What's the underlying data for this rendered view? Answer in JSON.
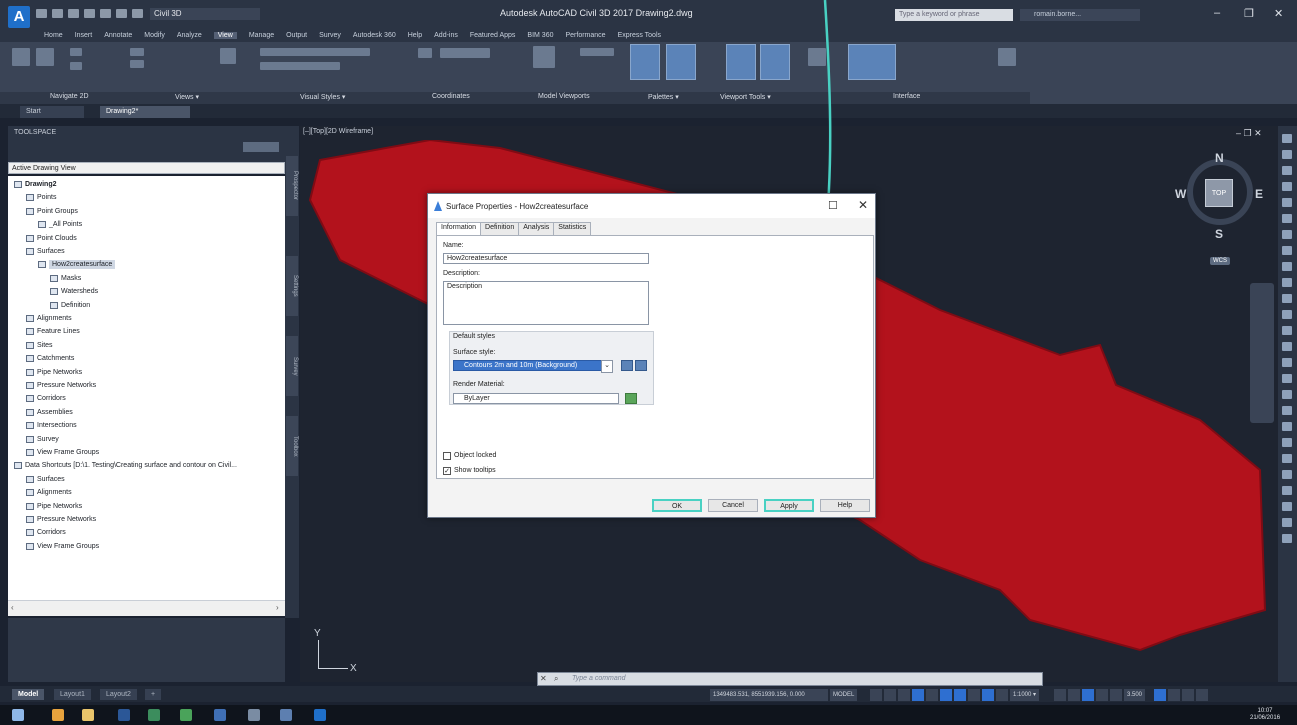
{
  "app": {
    "title": "Autodesk AutoCAD Civil 3D 2017   Drawing2.dwg",
    "logo": "A",
    "workspace": "Civil 3D",
    "search_placeholder": "Type a keyword or phrase",
    "user": "romain.borne...",
    "minimize": "–",
    "maximize": "❐",
    "close": "✕"
  },
  "menu": [
    "Home",
    "Insert",
    "Annotate",
    "Modify",
    "Analyze",
    "View",
    "Manage",
    "Output",
    "Survey",
    "Autodesk 360",
    "Help",
    "Add-ins",
    "Featured Apps",
    "BIM 360",
    "Performance",
    "Express Tools"
  ],
  "menu_active_index": 5,
  "ribbon_panels": [
    "Navigate 2D",
    "Views ▾",
    "Visual Styles ▾",
    "Coordinates",
    "Model Viewports",
    "Palettes ▾",
    "Viewport Tools ▾",
    "Interface"
  ],
  "file_tabs": [
    "Start",
    "Drawing2*"
  ],
  "toolspace": {
    "title": "TOOLSPACE",
    "view": "Active Drawing View",
    "tree": [
      {
        "label": "Drawing2",
        "level": 0,
        "bold": true
      },
      {
        "label": "Points",
        "level": 1
      },
      {
        "label": "Point Groups",
        "level": 1
      },
      {
        "label": "_All Points",
        "level": 2
      },
      {
        "label": "Point Clouds",
        "level": 1
      },
      {
        "label": "Surfaces",
        "level": 1
      },
      {
        "label": "How2createsurface",
        "level": 2,
        "selected": true
      },
      {
        "label": "Masks",
        "level": 3
      },
      {
        "label": "Watersheds",
        "level": 3
      },
      {
        "label": "Definition",
        "level": 3
      },
      {
        "label": "Alignments",
        "level": 1
      },
      {
        "label": "Feature Lines",
        "level": 1
      },
      {
        "label": "Sites",
        "level": 1
      },
      {
        "label": "Catchments",
        "level": 1
      },
      {
        "label": "Pipe Networks",
        "level": 1
      },
      {
        "label": "Pressure Networks",
        "level": 1
      },
      {
        "label": "Corridors",
        "level": 1
      },
      {
        "label": "Assemblies",
        "level": 1
      },
      {
        "label": "Intersections",
        "level": 1
      },
      {
        "label": "Survey",
        "level": 1
      },
      {
        "label": "View Frame Groups",
        "level": 1
      },
      {
        "label": "Data Shortcuts [D:\\1. Testing\\Creating surface and contour on Civil...",
        "level": 0
      },
      {
        "label": "Surfaces",
        "level": 1
      },
      {
        "label": "Alignments",
        "level": 1
      },
      {
        "label": "Pipe Networks",
        "level": 1
      },
      {
        "label": "Pressure Networks",
        "level": 1
      },
      {
        "label": "Corridors",
        "level": 1
      },
      {
        "label": "View Frame Groups",
        "level": 1
      }
    ],
    "side_tabs": [
      "Prospector",
      "Settings",
      "Survey",
      "Toolbox"
    ]
  },
  "viewport": {
    "label": "[–][Top][2D Wireframe]",
    "controls": "–  ❐  ✕",
    "surface_color": "#b3121c",
    "compass": {
      "n": "N",
      "s": "S",
      "e": "E",
      "w": "W",
      "top": "TOP",
      "wcs": "WCS"
    },
    "ucs": {
      "x": "X",
      "y": "Y"
    }
  },
  "dialog": {
    "title": "Surface Properties - How2createsurface",
    "tabs": [
      "Information",
      "Definition",
      "Analysis",
      "Statistics"
    ],
    "active_tab": 0,
    "name_label": "Name:",
    "name_value": "How2createsurface",
    "description_label": "Description:",
    "description_value": "Description",
    "default_styles_label": "Default styles",
    "surface_style_label": "Surface style:",
    "surface_style_value": "Contours 2m and 10m (Background)",
    "render_material_label": "Render Material:",
    "render_material_value": "ByLayer",
    "object_locked_label": "Object locked",
    "object_locked": false,
    "show_tooltips_label": "Show tooltips",
    "show_tooltips": true,
    "buttons": {
      "ok": "OK",
      "cancel": "Cancel",
      "apply": "Apply",
      "help": "Help"
    },
    "max_icon": "☐",
    "close_icon": "✕"
  },
  "command": {
    "placeholder": "Type a command",
    "close": "✕",
    "search": "⌕"
  },
  "layout_tabs": [
    "Model",
    "Layout1",
    "Layout2",
    "+"
  ],
  "status": {
    "coords": "1349483.531, 8551939.156, 0.000",
    "model": "MODEL",
    "scale": "1:1000 ▾",
    "zoom": "3.500"
  },
  "taskbar": {
    "time": "10:07",
    "date": "21/06/2016"
  },
  "colors": {
    "accent": "#2e6fd1",
    "highlight_arrow": "#49d1c3"
  }
}
